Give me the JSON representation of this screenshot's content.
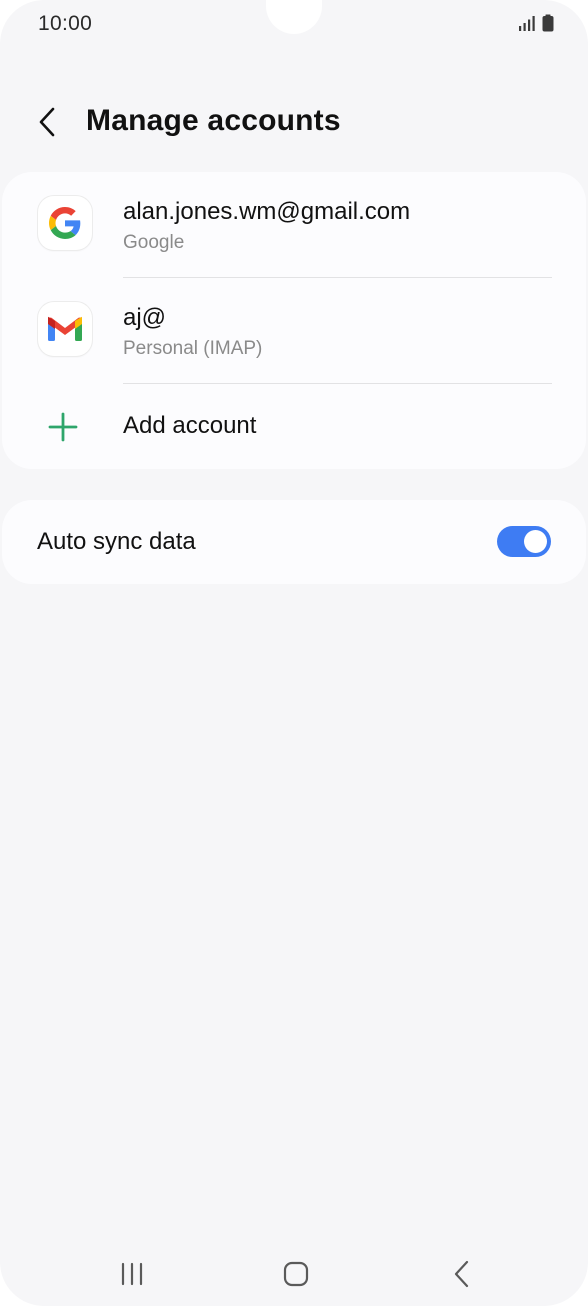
{
  "status_bar": {
    "time": "10:00",
    "icons": [
      "signal-icon",
      "battery-icon"
    ]
  },
  "header": {
    "title": "Manage accounts",
    "back_icon": "chevron-left-icon"
  },
  "accounts": [
    {
      "name": "alan.jones.wm@gmail.com",
      "type": "Google",
      "icon": "google-icon"
    },
    {
      "name": "aj@",
      "type": "Personal (IMAP)",
      "icon": "gmail-icon"
    }
  ],
  "add_account": {
    "label": "Add account",
    "icon": "plus-icon"
  },
  "auto_sync": {
    "label": "Auto sync data",
    "enabled": true
  },
  "nav_bar": {
    "icons": [
      "recents-icon",
      "home-icon",
      "back-icon"
    ]
  },
  "colors": {
    "background": "#f6f6f8",
    "card": "#fcfcfe",
    "toggle_on": "#3e7cf3",
    "add_icon": "#2ea56b",
    "secondary_text": "#8a8a8a"
  }
}
